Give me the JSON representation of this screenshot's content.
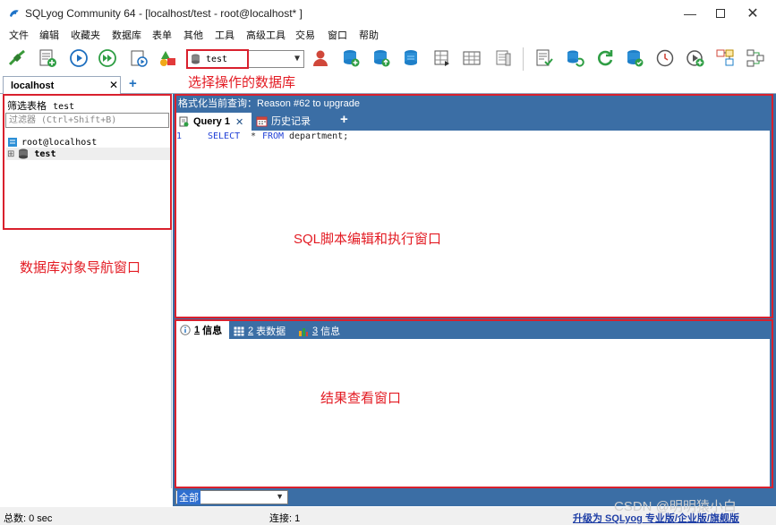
{
  "window": {
    "title": "SQLyog Community 64 - [localhost/test - root@localhost* ]"
  },
  "menu": [
    "文件",
    "编辑",
    "收藏夹",
    "数据库",
    "表单",
    "其他",
    "工具",
    "高级工具",
    "交易",
    "窗口",
    "帮助"
  ],
  "toolbar": {
    "db_selector_value": "test"
  },
  "connection_tab": {
    "label": "localhost",
    "add": "+"
  },
  "navigator": {
    "filter_label": "筛选表格",
    "filter_db": "test",
    "filter_placeholder": "过滤器 (Ctrl+Shift+B)",
    "root_label": "root@localhost",
    "db_label": "test",
    "expander": "⊞"
  },
  "query_panel": {
    "header": "格式化当前查询：Reason #62 to upgrade",
    "tabs": [
      {
        "label": "Query 1"
      },
      {
        "label": "历史记录"
      }
    ],
    "add_tab": "+",
    "code": {
      "line_no": "1",
      "kw_select": "SELECT",
      "star": "*",
      "kw_from": "FROM",
      "table": "department;"
    }
  },
  "result_panel": {
    "tabs": [
      {
        "num": "1",
        "label": "信息"
      },
      {
        "num": "2",
        "label": "表数据"
      },
      {
        "num": "3",
        "label": "信息"
      }
    ]
  },
  "bottom_select": {
    "value": "全部"
  },
  "status": {
    "total": "总数: 0 sec",
    "connection": "连接: 1",
    "upgrade_link": "升级为 SQLyog 专业版/企业版/旗舰版"
  },
  "annotations": {
    "db_select": "选择操作的数据库",
    "editor": "SQL脚本编辑和执行窗口",
    "navigator": "数据库对象导航窗口",
    "results": "结果查看窗口"
  },
  "watermark": "CSDN @明明猿小白",
  "colors": {
    "accent": "#3b6ea5",
    "annotation": "#e31b23",
    "keyword": "#1f3fd6"
  }
}
